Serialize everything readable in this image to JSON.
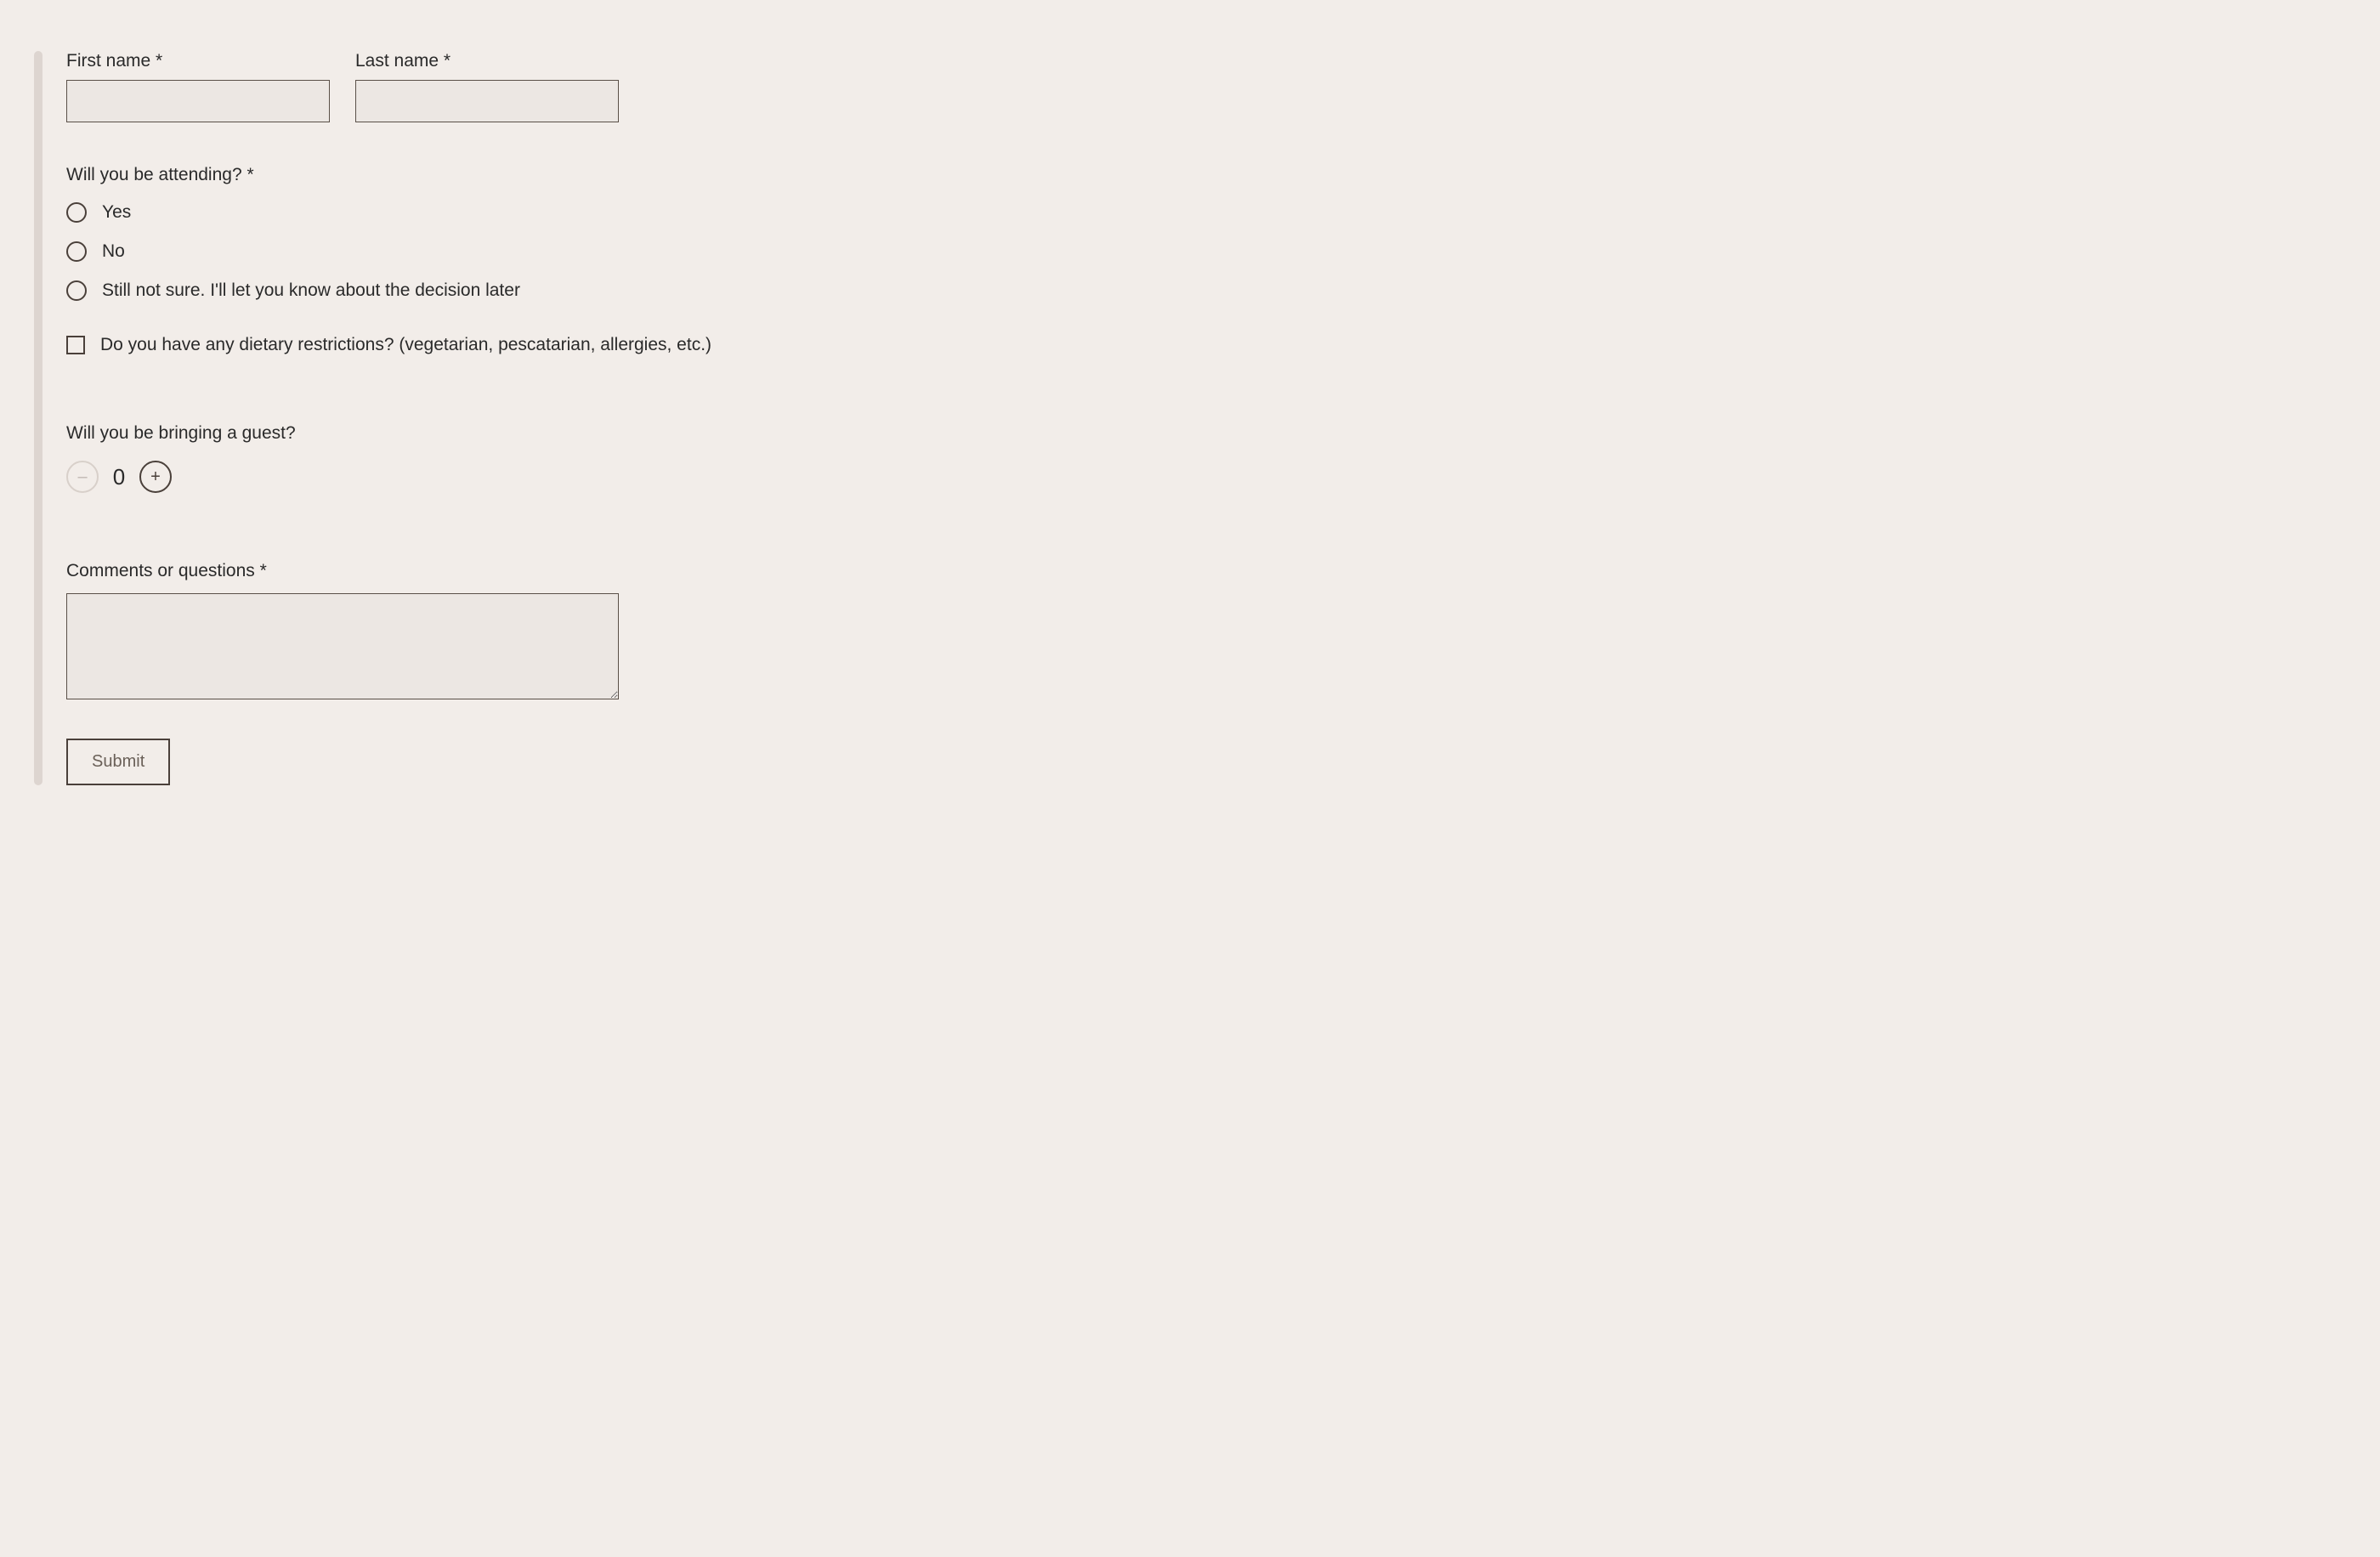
{
  "form": {
    "first_name": {
      "label": "First name *",
      "value": ""
    },
    "last_name": {
      "label": "Last name *",
      "value": ""
    },
    "attending": {
      "label": "Will you be attending? *",
      "options": [
        "Yes",
        "No",
        "Still not sure. I'll let you know about the decision later"
      ]
    },
    "dietary": {
      "label": "Do you have any dietary restrictions? (vegetarian, pescatarian, allergies, etc.)"
    },
    "guest": {
      "label": "Will you be bringing a guest?",
      "count": "0",
      "minus": "–",
      "plus": "+"
    },
    "comments": {
      "label": "Comments or questions *",
      "value": ""
    },
    "submit_label": "Submit"
  }
}
